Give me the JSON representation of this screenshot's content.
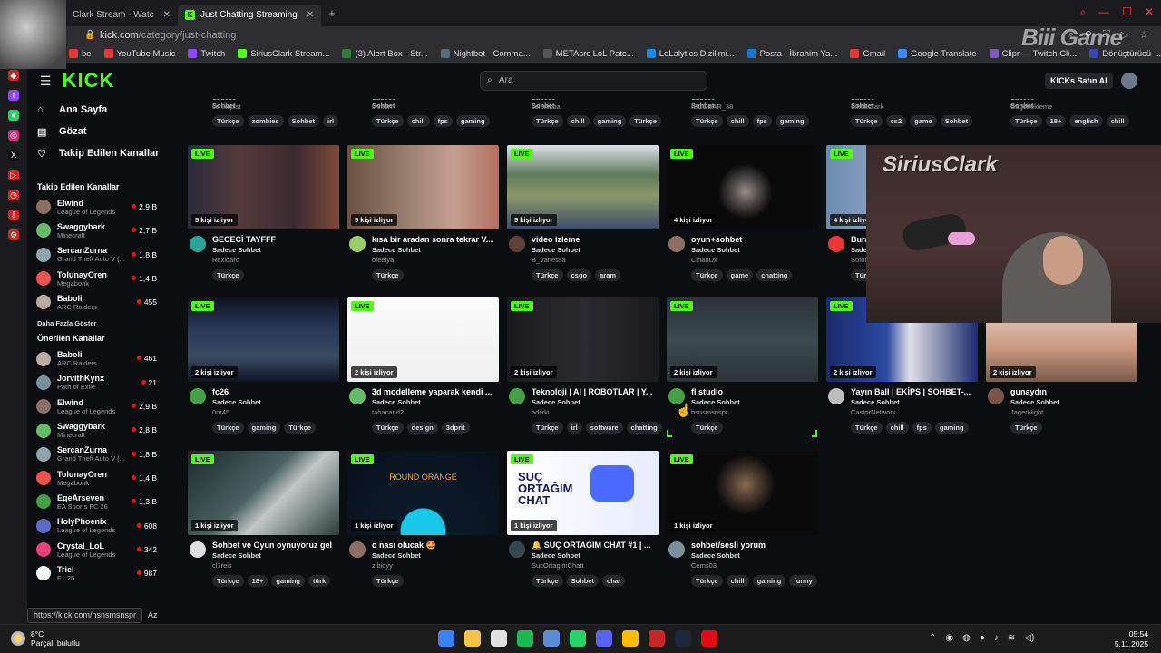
{
  "browser": {
    "tabs": [
      {
        "label": "Clark Stream - Watc",
        "active": false
      },
      {
        "label": "Just Chatting Streaming",
        "active": true
      }
    ],
    "new_tab": "+",
    "url_host": "kick.com",
    "url_path": "/category/just-chatting",
    "bookmarks": [
      {
        "label": "be",
        "color": "#e53935"
      },
      {
        "label": "YouTube Music",
        "color": "#e53935"
      },
      {
        "label": "Twitch",
        "color": "#9146ff"
      },
      {
        "label": "SiriusClark Stream...",
        "color": "#53fc18"
      },
      {
        "label": "(3) Alert Box - Str...",
        "color": "#2e7d32"
      },
      {
        "label": "Nightbot - Comma...",
        "color": "#546e7a"
      },
      {
        "label": "METAsrc LoL Patc...",
        "color": "#555"
      },
      {
        "label": "LoLalytics Dizilimi...",
        "color": "#1e88e5"
      },
      {
        "label": "Posta - İbrahim Ya...",
        "color": "#1976d2"
      },
      {
        "label": "Gmail",
        "color": "#e53935"
      },
      {
        "label": "Google Translate",
        "color": "#4285f4"
      },
      {
        "label": "Clipr — Twitch Cli...",
        "color": "#7e57c2"
      },
      {
        "label": "Dönüştürücü -...",
        "color": "#3949ab"
      }
    ],
    "overlay_brand": "Biii Game",
    "status_url": "https://kick.com/hsnsmsnspr"
  },
  "header": {
    "logo": "KICK",
    "search_placeholder": "Ara",
    "kicks_button": "KICKs Satın Al"
  },
  "sidebar": {
    "nav": [
      {
        "label": "Ana Sayfa",
        "icon": "home-icon",
        "glyph": "⌂"
      },
      {
        "label": "Gözat",
        "icon": "browse-icon",
        "glyph": "▤"
      },
      {
        "label": "Takip Edilen Kanallar",
        "icon": "heart-icon",
        "glyph": "♡"
      }
    ],
    "followed_title": "Takip Edilen Kanallar",
    "followed": [
      {
        "name": "Elwind",
        "game": "League of Legends",
        "viewers": "2,9 B",
        "color": "#8d6e63"
      },
      {
        "name": "Swaggybark",
        "game": "Minecraft",
        "viewers": "2,7 B",
        "color": "#66bb6a"
      },
      {
        "name": "SercanZurna",
        "game": "Grand Theft Auto V (...",
        "viewers": "1,8 B",
        "color": "#90a4ae"
      },
      {
        "name": "TolunayOren",
        "game": "Megabonk",
        "viewers": "1,4 B",
        "color": "#ef5350"
      },
      {
        "name": "Baboli",
        "game": "ARC Raiders",
        "viewers": "455",
        "color": "#bcaaa4"
      }
    ],
    "show_more": "Daha Fazla Göster",
    "recommended_title": "Önerilen Kanallar",
    "recommended": [
      {
        "name": "Baboli",
        "game": "ARC Raiders",
        "viewers": "461",
        "color": "#bcaaa4"
      },
      {
        "name": "JorvithKynx",
        "game": "Path of Exile",
        "viewers": "21",
        "color": "#78909c"
      },
      {
        "name": "Elwind",
        "game": "League of Legends",
        "viewers": "2,9 B",
        "color": "#8d6e63"
      },
      {
        "name": "Swaggybark",
        "game": "Minecraft",
        "viewers": "2,8 B",
        "color": "#66bb6a"
      },
      {
        "name": "SercanZurna",
        "game": "Grand Theft Auto V (...",
        "viewers": "1,8 B",
        "color": "#90a4ae"
      },
      {
        "name": "TolunayOren",
        "game": "Megabonk",
        "viewers": "1,4 B",
        "color": "#ef5350"
      },
      {
        "name": "EgeArseven",
        "game": "EA Sports FC 26",
        "viewers": "1,3 B",
        "color": "#43a047"
      },
      {
        "name": "HolyPhoenix",
        "game": "League of Legends",
        "viewers": "608",
        "color": "#5c6bc0"
      },
      {
        "name": "Crystal_LoL",
        "game": "League of Legends",
        "viewers": "342",
        "color": "#ec407a"
      },
      {
        "name": "Triel",
        "game": "F1 25",
        "viewers": "987",
        "color": "#fafafa"
      }
    ],
    "bottom": "Az"
  },
  "top_row": [
    {
      "user": "senkopist",
      "tags": [
        "Türkçe",
        "zombies",
        "Sohbet",
        "irl"
      ]
    },
    {
      "user": "shiiren",
      "tags": [
        "Türkçe",
        "chill",
        "fps",
        "gaming"
      ]
    },
    {
      "user": "selenikbal",
      "tags": [
        "Türkçe",
        "chill",
        "gaming",
        "Türkçe"
      ]
    },
    {
      "user": "ISCOBAR_38",
      "tags": [
        "Türkçe",
        "chill",
        "fps",
        "gaming"
      ]
    },
    {
      "user": "SiriusClark",
      "tags": [
        "Türkçe",
        "cs2",
        "game",
        "Sohbet"
      ]
    },
    {
      "user": "Cagobekleme",
      "tags": [
        "Türkçe",
        "18+",
        "english",
        "chill"
      ]
    }
  ],
  "top_category": "Sadece Sohbet",
  "live_label": "LIVE",
  "rows": [
    [
      {
        "viewers": "5 kişi izliyor",
        "title": "GECECİ TAYFFF",
        "category": "Sadece Sohbet",
        "user": "Rexloard",
        "tags": [
          "Türkçe"
        ],
        "thumb": "linear-gradient(90deg,#2a2a3a 0,#553a3a 35%,#3a2a30 70%,#7a4a3a 100%)",
        "avatar": "#26a69a"
      },
      {
        "viewers": "5 kişi izliyor",
        "title": "kısa bir aradan sonra tekrar V...",
        "category": "Sadece Sohbet",
        "user": "ofeelya",
        "tags": [
          "Türkçe"
        ],
        "thumb": "linear-gradient(90deg,#6a5040 0,#9a8070 40%,#c4a090 70%,#b07060 100%)",
        "avatar": "#9ccc65"
      },
      {
        "viewers": "5 kişi izliyor",
        "title": "video izleme",
        "category": "Sadece Sohbet",
        "user": "B_Vanessa",
        "tags": [
          "Türkçe",
          "csgo",
          "aram"
        ],
        "thumb": "linear-gradient(180deg,#dde0e8 0,#5e7a5a 35%,#8a9a6a 60%,#3a4a6a 100%)",
        "avatar": "#5d4037"
      },
      {
        "viewers": "4 kişi izliyor",
        "title": "oyun+sohbet",
        "category": "Sadece Sohbet",
        "user": "CihanDx",
        "tags": [
          "Türkçe",
          "game",
          "chatting"
        ],
        "thumb": "radial-gradient(circle at 52% 55%,#9a9088 0,#5a5450 12%,#0a0a0a 30%)",
        "avatar": "#8d6e63"
      },
      {
        "viewers": "4 kişi izliyor",
        "title": "Burak Berkay",
        "category": "Sadece Sohbet",
        "user": "Sofor",
        "tags": [
          "Türkçe"
        ],
        "thumb": "linear-gradient(90deg,#6a8ab0 0,#a0b8d0 60%)",
        "avatar": "#e53935"
      },
      {
        "viewers": "",
        "title": "",
        "category": "",
        "user": "",
        "tags": [],
        "thumb": "#222",
        "avatar": "#444"
      }
    ],
    [
      {
        "viewers": "2 kişi izliyor",
        "title": "fc26",
        "category": "Sadece Sohbet",
        "user": "0nr45",
        "tags": [
          "Türkçe",
          "gaming",
          "Türkçe"
        ],
        "thumb": "linear-gradient(180deg,#0e1420 0,#2a3a5a 40%,#3a4a60 70%,#0e1420 100%)",
        "avatar": "#43a047"
      },
      {
        "viewers": "2 kişi izliyor",
        "title": "3d modelleme yaparak kendi ...",
        "category": "Sadece Sohbet",
        "user": "tahacand2",
        "tags": [
          "Türkçe",
          "design",
          "3dprit"
        ],
        "thumb": "linear-gradient(180deg,#fafafa 0,#f0f0f0 100%)",
        "avatar": "#66bb6a"
      },
      {
        "viewers": "2 kişi izliyor",
        "title": "Teknoloji | AI | ROBOTLAR | Y...",
        "category": "Sadece Sohbet",
        "user": "adiirki",
        "tags": [
          "Türkçe",
          "irl",
          "software",
          "chatting"
        ],
        "thumb": "linear-gradient(90deg,#1a1a1e 0,#2a2a30 50%,#1a1a1e 100%)",
        "avatar": "#43a047"
      },
      {
        "viewers": "2 kişi izliyor",
        "title": "fl studio",
        "category": "Sadece Sohbet",
        "user": "hsnsmsnspr",
        "tags": [
          "Türkçe"
        ],
        "thumb": "linear-gradient(180deg,#2a3238 0,#3a4a50 50%,#2a3238 100%)",
        "avatar": "#43a047"
      },
      {
        "viewers": "2 kişi izliyor",
        "title": "Yayın Ball | EKİPS | SOHBET-...",
        "category": "Sadece Sohbet",
        "user": "CastorNetwork",
        "tags": [
          "Türkçe",
          "chill",
          "fps",
          "gaming"
        ],
        "thumb": "linear-gradient(90deg,#1a2a6a 0,#2a4aa0 40%,#e0e0e8 55%,#1a2a6a 100%)",
        "avatar": "#bdbdbd"
      },
      {
        "viewers": "2 kişi izliyor",
        "title": "gunaydın",
        "category": "Sadece Sohbet",
        "user": "JagerNight",
        "tags": [
          "Türkçe"
        ],
        "thumb": "linear-gradient(180deg,#f0d8c8 0,#c89a80 60%,#7a5a4a 100%)",
        "avatar": "#795548"
      }
    ],
    [
      {
        "viewers": "1 kişi izliyor",
        "title": "Sohbet ve Oyun oynuyoruz gel",
        "category": "Sadece Sohbet",
        "user": "cl7reis",
        "tags": [
          "Türkçe",
          "18+",
          "gaming",
          "türk"
        ],
        "thumb": "linear-gradient(135deg,#1a2a2a 0,#4a6060 45%,#c0c8c8 60%,#2a3a3a 100%)",
        "avatar": "#e0e0e0"
      },
      {
        "viewers": "1 kişi izliyor",
        "title": "o nası olucak 🤩",
        "category": "Sadece Sohbet",
        "user": "zibidyy",
        "tags": [
          "Türkçe"
        ],
        "thumb": "radial-gradient(circle at 50% 95%,#19c7e8 0,#19c7e8 20%,#0a1a2a 21%,#081018 100%)",
        "avatar": "#8d6e63"
      },
      {
        "viewers": "1 kişi izliyor",
        "title": "🔔 SUÇ ORTAĞIM CHAT #1 | ...",
        "category": "Sadece Sohbet",
        "user": "SucOrtagimChatt",
        "tags": [
          "Türkçe",
          "Sohbet",
          "chat"
        ],
        "thumb": "linear-gradient(90deg,#ffffff 0,#f4f6ff 50%,#e4ecff 100%)",
        "avatar": "#37474f"
      },
      {
        "viewers": "1 kişi izliyor",
        "title": "sohbet/sesli yorum",
        "category": "Sadece Sohbet",
        "user": "Cems03",
        "tags": [
          "Türkçe",
          "chill",
          "gaming",
          "funny"
        ],
        "thumb": "radial-gradient(circle at 52% 40%,#8a6a50 0,#4a3a30 15%,#0a0a0a 32%)",
        "avatar": "#78909c"
      }
    ]
  ],
  "thumb_text": {
    "round_orange": "ROUND ORANGE",
    "suc_ortagim": "SUÇ ORTAĞIM CHAT"
  },
  "webcam_logo": "SiriusClark",
  "taskbar": {
    "temp": "8°C",
    "weather": "Parçalı bulutlu",
    "time": "05:54",
    "date": "5.11.2025",
    "apps": [
      "#3b82f6",
      "#f5c542",
      "#e0e0e0",
      "#1db954",
      "#5b8bd0",
      "#25d366",
      "#5865f2",
      "#fbbc05",
      "#c62828",
      "#1b2838",
      "#e50914"
    ]
  }
}
